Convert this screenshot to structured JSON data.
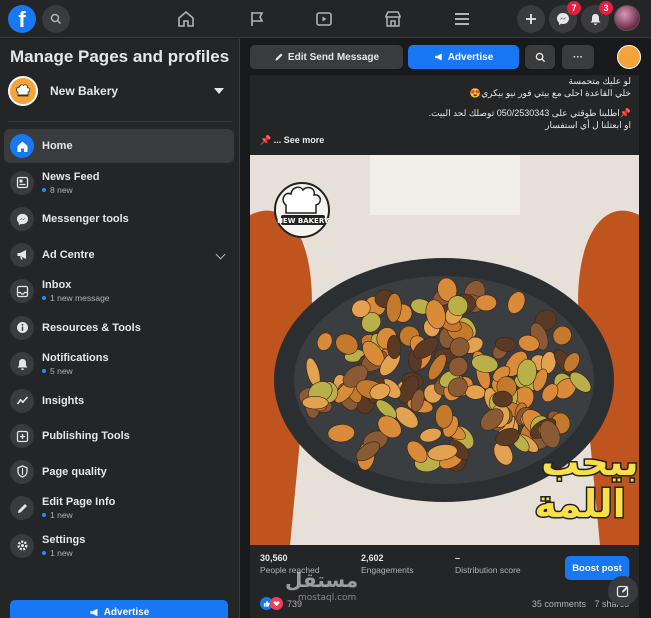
{
  "topbar": {
    "logo": "f",
    "messenger_badge": "7",
    "notifications_badge": "3",
    "icons": [
      "search-icon",
      "home-icon",
      "flag-icon",
      "watch-icon",
      "marketplace-icon",
      "menu-icon",
      "plus-icon",
      "messenger-icon",
      "bell-icon"
    ]
  },
  "sidebar": {
    "title": "Manage Pages and profiles",
    "page_name": "New Bakery",
    "items": [
      {
        "label": "Home",
        "sub": "",
        "icon": "home-icon",
        "active": true
      },
      {
        "label": "News Feed",
        "sub": "8 new",
        "icon": "news-feed-icon"
      },
      {
        "label": "Messenger tools",
        "sub": "",
        "icon": "messenger-icon"
      },
      {
        "label": "Ad Centre",
        "sub": "",
        "icon": "megaphone-icon"
      },
      {
        "label": "Inbox",
        "sub": "1 new message",
        "icon": "inbox-icon"
      },
      {
        "label": "Resources & Tools",
        "sub": "",
        "icon": "info-icon"
      },
      {
        "label": "Notifications",
        "sub": "5 new",
        "icon": "bell-icon"
      },
      {
        "label": "Insights",
        "sub": "",
        "icon": "insights-icon"
      },
      {
        "label": "Publishing Tools",
        "sub": "",
        "icon": "publishing-icon"
      },
      {
        "label": "Page quality",
        "sub": "",
        "icon": "shield-icon"
      },
      {
        "label": "Edit Page Info",
        "sub": "1 new",
        "icon": "pencil-icon"
      },
      {
        "label": "Settings",
        "sub": "1 new",
        "icon": "gear-icon"
      }
    ],
    "advertise_label": "Advertise"
  },
  "action_bar": {
    "edit_send_message": "Edit Send Message",
    "advertise": "Advertise",
    "more": "···"
  },
  "post": {
    "lines": [
      "لو عليك متحمسة",
      "خلي القاعدة احلى مع بيتي فور نيو بيكري😍",
      "📌اطلبنا طوقتي على 050/2530343 توصلك لحد البيت.",
      "او ابعتلنا ل أي استفسار"
    ],
    "see_more": "... See more",
    "photo_logo_text": "NEW BAKERY",
    "photo_overlay_line1": "بيحب",
    "photo_overlay_line2": "اللمة",
    "stats": [
      {
        "value": "30,560",
        "label": "People reached"
      },
      {
        "value": "2,602",
        "label": "Engagements"
      },
      {
        "value": "–",
        "label": "Distribution score"
      }
    ],
    "boost_label": "Boost post",
    "reaction_count": "739",
    "comments": "35 comments",
    "shares": "7 shares"
  },
  "watermark": {
    "main": "مستقل",
    "sub": "mostaql.com"
  },
  "colors": {
    "accent": "#1877f2",
    "background": "#18191a",
    "surface": "#242526",
    "badge": "#e41e3f"
  }
}
